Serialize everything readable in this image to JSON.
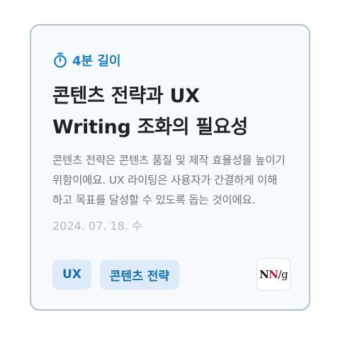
{
  "card": {
    "read_time": "4분 길이",
    "read_time_icon": "stopwatch-icon",
    "title_line1": "콘텐츠 전략과 UX",
    "title_line2": "Writing 조화의 필요성",
    "description": "콘텐츠 전략은 콘텐츠 품질 및 제작 효율성을 높이기 위함이에요. UX 라이팅은 사용자가 간결하게 이해하고 목표를 달성할 수 있도록 돕는 것이에요.",
    "date": "2024. 07. 18. 수",
    "tags": [
      "UX",
      "콘텐츠 전략"
    ],
    "source": {
      "logo_text": "NN/g",
      "logo_parts": [
        "N",
        "N",
        "/",
        "g"
      ],
      "colors": {
        "n1": "#111111",
        "n2": "#c8102e"
      }
    },
    "colors": {
      "accent": "#1a7fc6",
      "border": "#a9c3d6",
      "tag_bg": "#dcebf7",
      "title": "#1e2226"
    }
  }
}
